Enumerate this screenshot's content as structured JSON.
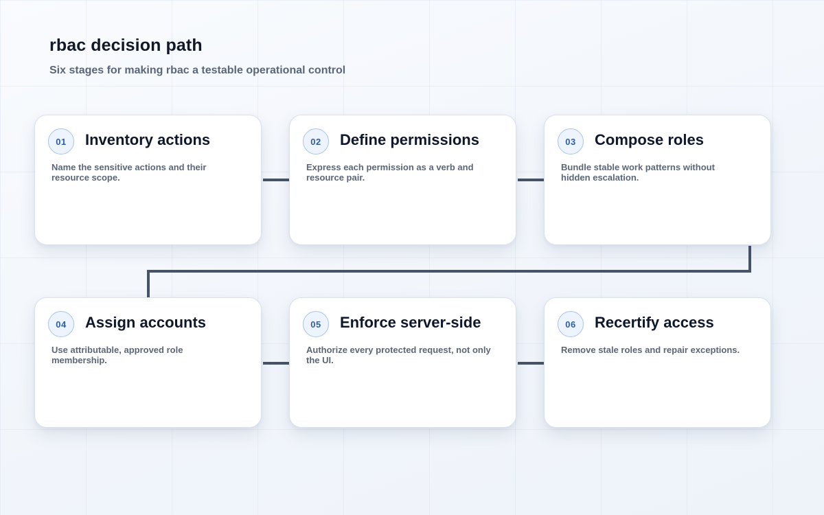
{
  "header": {
    "title": "rbac decision path",
    "subtitle": "Six stages for making rbac a testable operational control"
  },
  "stages": [
    {
      "number": "01",
      "title": "Inventory actions",
      "description": "Name the sensitive actions and their resource scope."
    },
    {
      "number": "02",
      "title": "Define permissions",
      "description": "Express each permission as a verb and resource pair."
    },
    {
      "number": "03",
      "title": "Compose roles",
      "description": "Bundle stable work patterns without hidden escalation."
    },
    {
      "number": "04",
      "title": "Assign accounts",
      "description": "Use attributable, approved role membership."
    },
    {
      "number": "05",
      "title": "Enforce server-side",
      "description": "Authorize every protected request, not only the UI."
    },
    {
      "number": "06",
      "title": "Recertify access",
      "description": "Remove stale roles and repair exceptions."
    }
  ],
  "colors": {
    "connector": "#475366",
    "badge_text": "#2f5ea6",
    "badge_border": "#a9c3ea"
  }
}
